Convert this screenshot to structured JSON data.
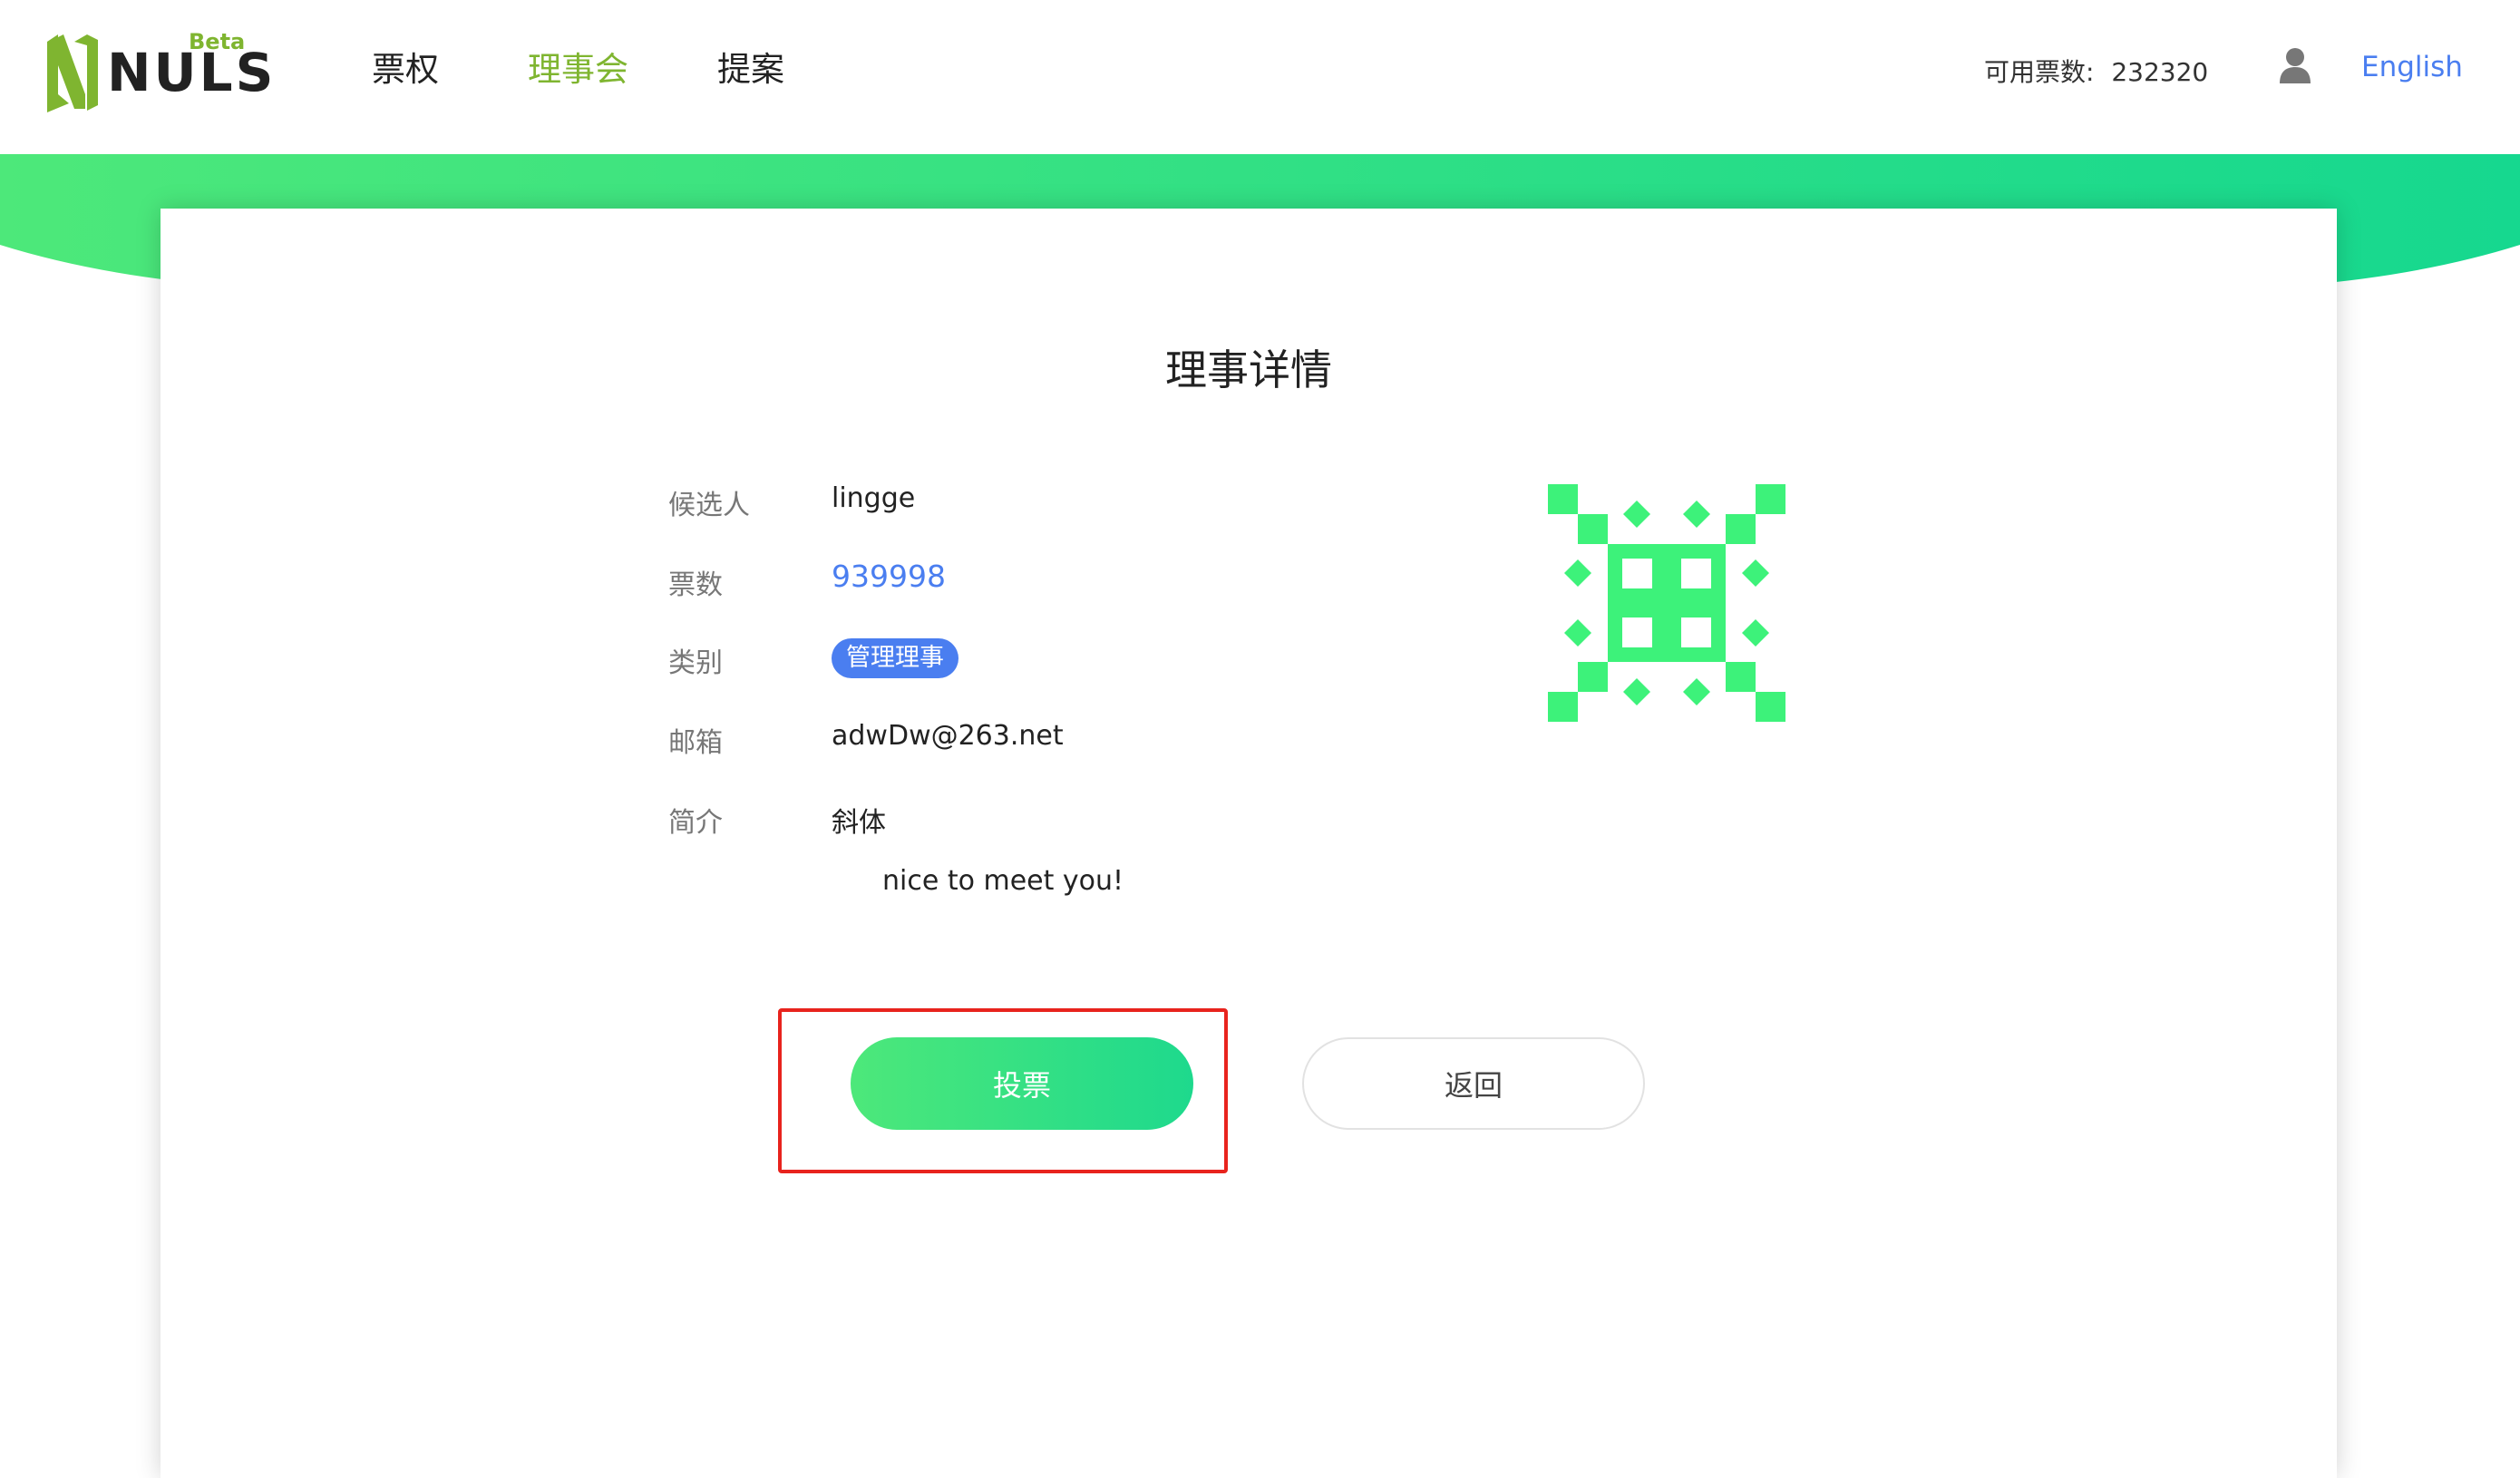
{
  "header": {
    "logo_text": "NULS",
    "logo_badge": "Beta",
    "nav": [
      {
        "label": "票权",
        "active": false
      },
      {
        "label": "理事会",
        "active": true
      },
      {
        "label": "提案",
        "active": false
      }
    ],
    "votes_label": "可用票数:",
    "votes_value": "232320",
    "user_icon": "user-icon",
    "language": "English"
  },
  "detail": {
    "title": "理事详情",
    "fields": {
      "candidate_label": "候选人",
      "candidate_value": "lingge",
      "votes_label": "票数",
      "votes_value": "939998",
      "category_label": "类别",
      "category_value": "管理理事",
      "email_label": "邮箱",
      "email_value": "adwDw@263.net",
      "intro_label": "简介",
      "intro_value": "斜体",
      "intro_body": "nice to meet you!"
    },
    "avatar_icon": "identicon-avatar",
    "buttons": {
      "vote": "投票",
      "back": "返回"
    }
  },
  "colors": {
    "accent_green": "#7fb530",
    "link_blue": "#4a7ef0",
    "banner_start": "#4de87a",
    "banner_end": "#16d88f",
    "identicon": "#3df27a",
    "highlight_red": "#e8231d"
  }
}
